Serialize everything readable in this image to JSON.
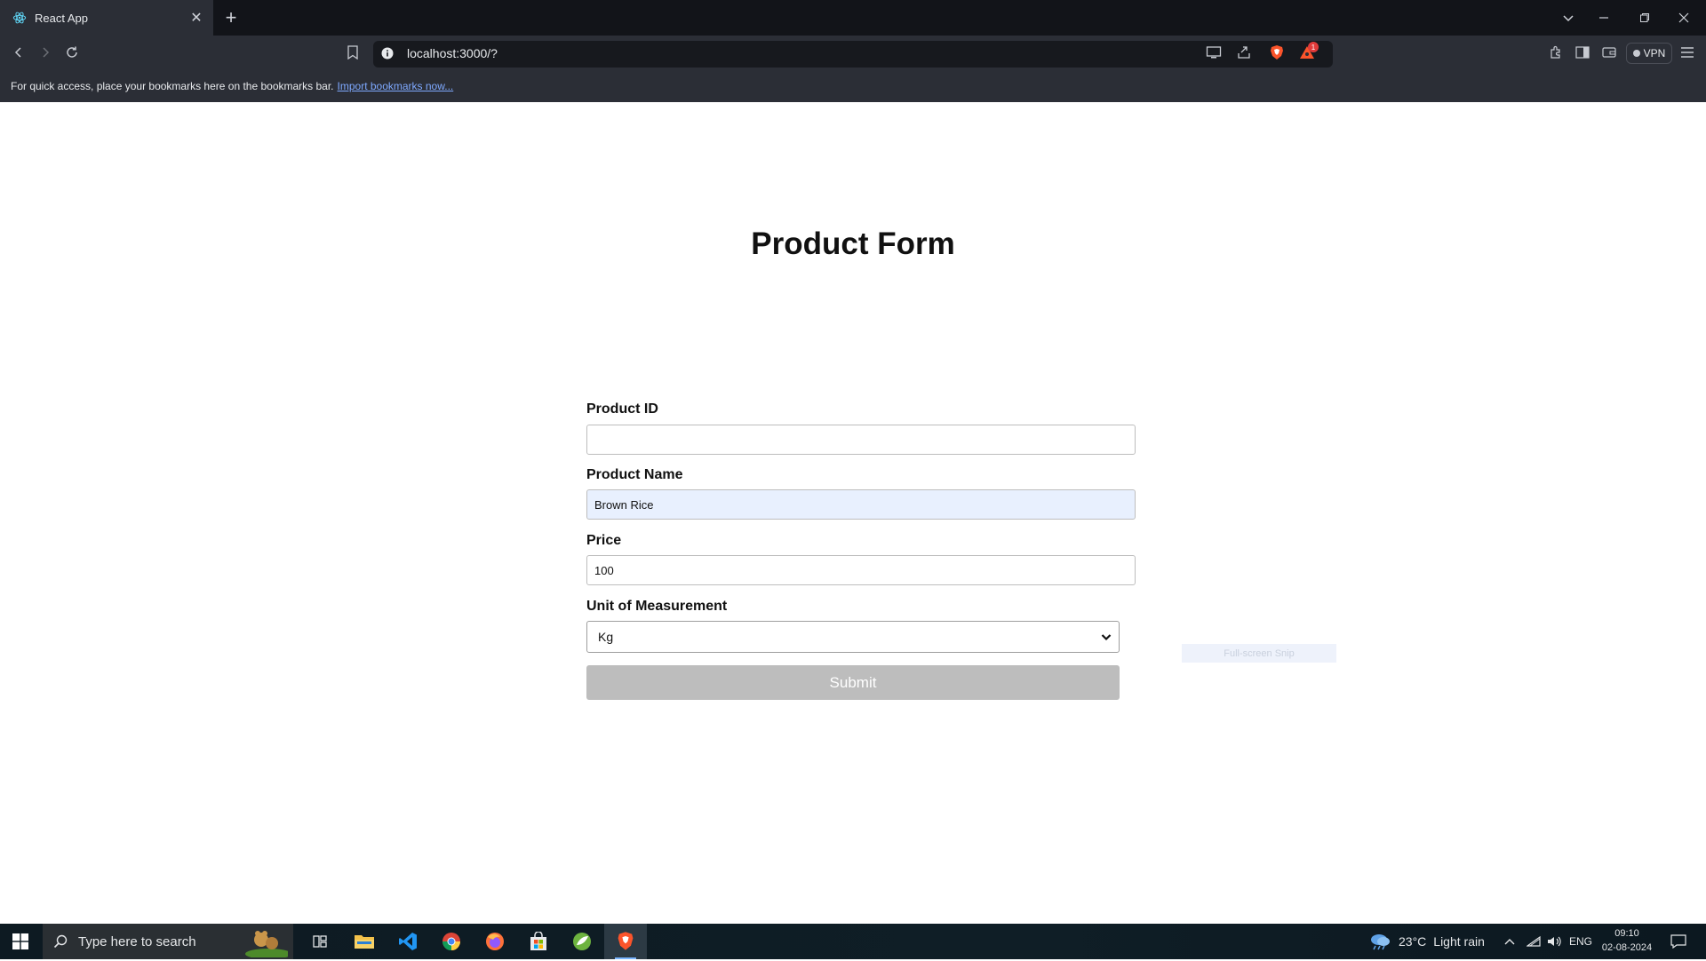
{
  "browser": {
    "tab_title": "React App",
    "url": "localhost:3000/?",
    "vpn_label": "VPN",
    "notification_count": "1",
    "bookmarks_bar_text": "For quick access, place your bookmarks here on the bookmarks bar.",
    "bookmarks_import_link": "Import bookmarks now..."
  },
  "form": {
    "title": "Product Form",
    "fields": {
      "product_id": {
        "label": "Product ID",
        "value": ""
      },
      "product_name": {
        "label": "Product Name",
        "value": "Brown Rice"
      },
      "price": {
        "label": "Price",
        "value": "100"
      },
      "unit": {
        "label": "Unit of Measurement",
        "selected": "Kg"
      }
    },
    "submit_label": "Submit"
  },
  "overlay": {
    "snip_text": "Full-screen Snip"
  },
  "taskbar": {
    "search_placeholder": "Type here to search",
    "weather": {
      "temp": "23°C",
      "condition": "Light rain"
    },
    "language": "ENG",
    "time": "09:10",
    "date": "02-08-2024"
  },
  "colors": {
    "submit_disabled": "#bdbdbd",
    "autofill_bg": "#e8f0fe",
    "link": "#7ea9ff",
    "brave_orange": "#fb542b"
  }
}
